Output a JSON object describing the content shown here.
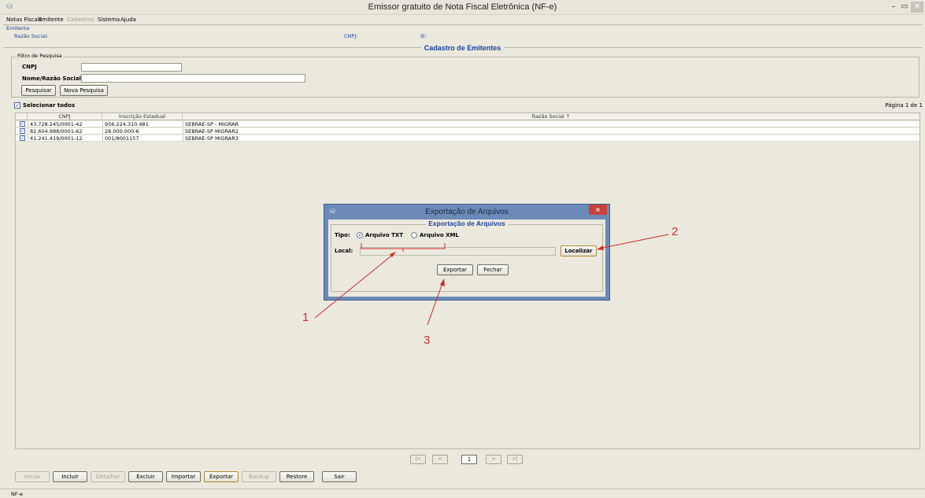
{
  "window": {
    "title": "Emissor gratuito de Nota Fiscal Eletrônica (NF-e)",
    "app_icon": "nfe-app-icon",
    "min": "–",
    "max": "▭",
    "close": "✕"
  },
  "menu": [
    "Notas Fiscais",
    "Emitente",
    "Cadastros",
    "Sistema",
    "Ajuda"
  ],
  "emitente": {
    "legend": "Emitente",
    "razao_label": "Razão Social:",
    "cnpj_label": "CNPJ:",
    "ie_label": "IE:"
  },
  "section_title": "Cadastro de Emitentes",
  "filter": {
    "legend": "Filtro de Pesquisa",
    "cnpj_label": "CNPJ",
    "nome_label": "Nome/Razão Social",
    "cnpj_value": "",
    "nome_value": "",
    "search_button": "Pesquisar",
    "new_search_button": "Nova Pesquisa"
  },
  "select_all": {
    "label": "Selecionar todos",
    "checked": true
  },
  "page_info": "Página 1 de 1",
  "table": {
    "headers": [
      "CNPJ",
      "Inscrição Estadual",
      "Razão Social ↑"
    ],
    "rows": [
      {
        "checked": true,
        "cnpj": "43.728.245/0001-42",
        "ie": "956.224.310.481",
        "razao": "SEBRAE-SP - MIGRAR"
      },
      {
        "checked": true,
        "cnpj": "82.604.988/0001-62",
        "ie": "28.000.000-6",
        "razao": "SEBRAE-SP MIGRAR2"
      },
      {
        "checked": true,
        "cnpj": "41.241.419/0001-12",
        "ie": "001/8001157",
        "razao": "SEBRAE-SP MIGRAR3"
      }
    ]
  },
  "pager": {
    "first": "|<",
    "prev": "<",
    "page": "1",
    "next": ">",
    "last": ">|"
  },
  "actions": [
    "Iniciar",
    "Incluir",
    "Detalhar",
    "Excluir",
    "Importar",
    "Exportar",
    "Backup",
    "Restore",
    "Sair"
  ],
  "status": "NF-e",
  "dialog": {
    "title": "Exportação de Arquivos",
    "legend": "Exportação de Arquivos",
    "tipo_label": "Tipo:",
    "option_txt": "Arquivo TXT",
    "option_xml": "Arquivo XML",
    "selected": "txt",
    "local_label": "Local:",
    "local_value": "",
    "locate_button": "Localizar",
    "export_button": "Exportar",
    "close_button": "Fechar",
    "close_x": "×"
  },
  "annotations": [
    "1",
    "2",
    "3"
  ],
  "colors": {
    "accent": "#1a3fa0",
    "annotation": "#d12a2a",
    "dialog_frame": "#6b8ab8",
    "close": "#c6423a"
  }
}
